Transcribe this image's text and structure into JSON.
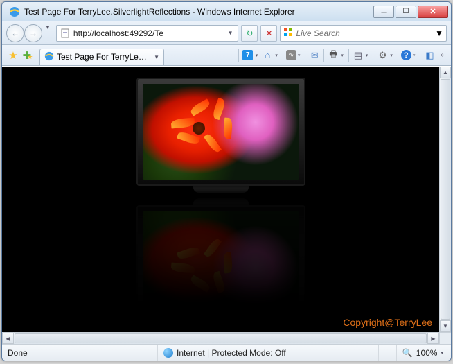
{
  "window": {
    "title": "Test Page For TerryLee.SilverlightReflections - Windows Internet Explorer"
  },
  "nav": {
    "url": "http://localhost:49292/Te",
    "back_label": "←",
    "forward_label": "→"
  },
  "search": {
    "placeholder": "Live Search"
  },
  "tab": {
    "label": "Test Page For TerryLee...."
  },
  "toolbar": {
    "seven": "7"
  },
  "content": {
    "copyright": "Copyright@TerryLee"
  },
  "status": {
    "done": "Done",
    "zone": "Internet | Protected Mode: Off",
    "zoom": "100%"
  }
}
